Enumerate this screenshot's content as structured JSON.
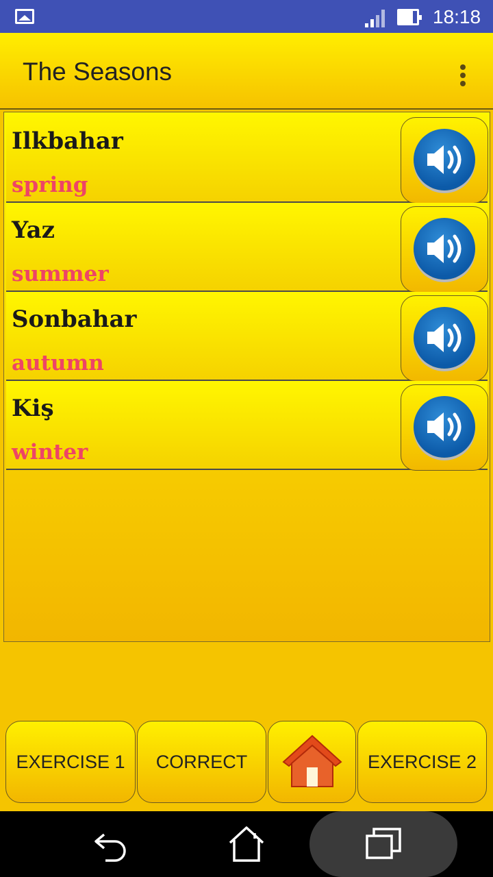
{
  "status_bar": {
    "time": "18:18",
    "icons": [
      "gallery-icon",
      "signal-icon",
      "battery-icon"
    ]
  },
  "app_bar": {
    "title": "The Seasons",
    "menu_icon": "overflow-menu-icon"
  },
  "words": [
    {
      "word": "Ilkbahar",
      "translation": "spring"
    },
    {
      "word": "Yaz",
      "translation": "summer"
    },
    {
      "word": "Sonbahar",
      "translation": "autumn"
    },
    {
      "word": "Kiş",
      "translation": "winter"
    }
  ],
  "bottom_buttons": {
    "exercise1": "EXERCISE 1",
    "correct": "CORRECT",
    "home_icon": "home-icon",
    "exercise2": "EXERCISE 2"
  },
  "nav_bar": {
    "icons": [
      "back-icon",
      "home-icon",
      "recents-icon"
    ]
  },
  "colors": {
    "background": "#f5c400",
    "translation_text": "#ee4466",
    "status_bar": "#3f51b5",
    "speaker": "#1a6fc0"
  }
}
